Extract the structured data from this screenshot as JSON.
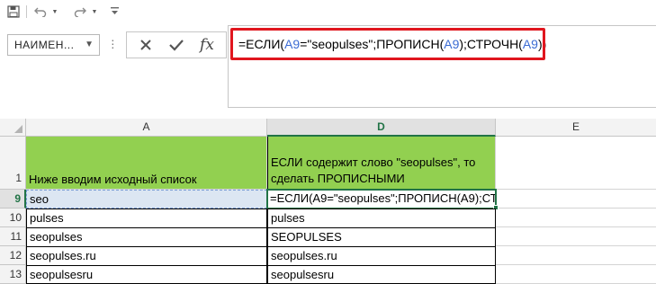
{
  "quick_access": {
    "save_icon": "save-icon",
    "undo_icon": "undo-icon",
    "redo_icon": "redo-icon",
    "customize_icon": "customize-qat-icon"
  },
  "name_box": {
    "value": "НАИМЕН..."
  },
  "formula_bar": {
    "parts": [
      "=ЕСЛИ(",
      "A9",
      "=\"seopulses\";ПРОПИСН(",
      "A9",
      ");СТРОЧН(",
      "A9",
      "))"
    ],
    "cancel_icon": "cancel-icon",
    "enter_icon": "enter-icon",
    "fx_label": "fx"
  },
  "colors": {
    "highlight": "#e0161e",
    "header_fill": "#92d050",
    "ref_color": "#3b6bd3",
    "accent": "#217346"
  },
  "columns": {
    "a": "A",
    "d": "D",
    "e": "E"
  },
  "rows": [
    {
      "num": "1",
      "a": "Ниже вводим исходный список",
      "d": "ЕСЛИ содержит слово \"seopulses\", то сделать ПРОПИСНЫМИ"
    },
    {
      "num": "9",
      "a": "seo",
      "d": "=ЕСЛИ(A9=\"seopulses\";ПРОПИСН(A9);СТ"
    },
    {
      "num": "10",
      "a": "pulses",
      "d": "pulses"
    },
    {
      "num": "11",
      "a": "seopulses",
      "d": "SEOPULSES"
    },
    {
      "num": "12",
      "a": "seopulses.ru",
      "d": "seopulses.ru"
    },
    {
      "num": "13",
      "a": "seopulsesru",
      "d": "seopulsesru"
    }
  ]
}
